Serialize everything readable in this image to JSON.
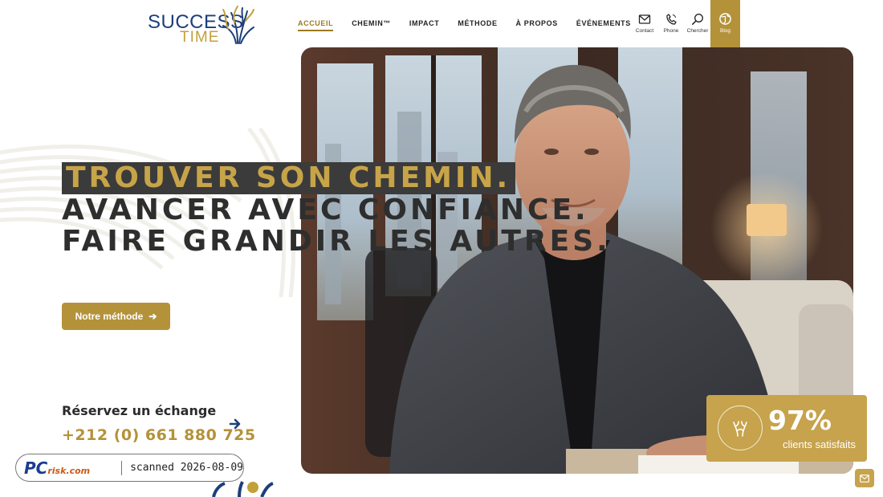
{
  "brand": {
    "word1": "SUCCESS",
    "word2": "TIME",
    "navy": "#1d3f7a",
    "gold": "#b4923a"
  },
  "nav": {
    "items": [
      {
        "label": "ACCUEIL",
        "active": true
      },
      {
        "label": "CHEMIN™",
        "active": false
      },
      {
        "label": "IMPACT",
        "active": false
      },
      {
        "label": "MÉTHODE",
        "active": false
      },
      {
        "label": "À PROPOS",
        "active": false
      },
      {
        "label": "ÉVÉNEMENTS",
        "active": false
      }
    ]
  },
  "tools": {
    "contact": {
      "label": "Contact",
      "icon": "envelope-icon"
    },
    "phone": {
      "label": "Phone",
      "icon": "phone-icon"
    },
    "search": {
      "label": "Chercher",
      "icon": "search-icon"
    },
    "blog": {
      "label": "Blog",
      "icon": "globe-icon"
    }
  },
  "hero": {
    "line1": "TROUVER SON CHEMIN.",
    "line2": "AVANCER AVEC CONFIANCE.",
    "line3": "FAIRE GRANDIR LES AUTRES.",
    "cta_label": "Notre méthode",
    "image": "man-in-blazer-photo"
  },
  "booking": {
    "title": "Réservez un échange",
    "phone": "+212 (0) 661 880 725"
  },
  "stat": {
    "value": "97%",
    "label": "clients satisfaits",
    "icon": "tree-icon"
  },
  "watermark": {
    "logo_main": "PC",
    "logo_sub": "risk.com",
    "text": "scanned 2026-08-09"
  },
  "mail_fab_icon": "mail-icon"
}
